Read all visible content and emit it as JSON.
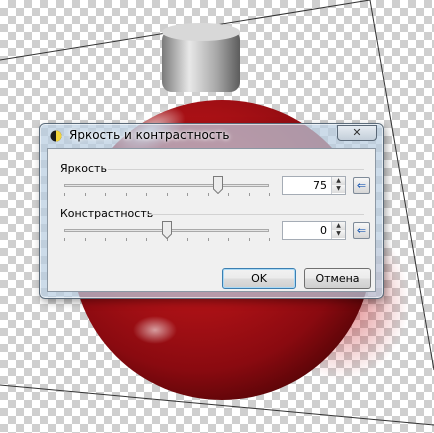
{
  "dialog": {
    "title": "Яркость и контрастность",
    "close_label": "✕",
    "brightness": {
      "label": "Яркость",
      "value": "75",
      "level": 0.75
    },
    "contrast": {
      "label": "Констрастность",
      "value": "0",
      "level": 0.5
    },
    "spin_up": "▲",
    "spin_down": "▼",
    "reset_label": "⇐",
    "ok_label": "OK",
    "cancel_label": "Отмена"
  },
  "colors": {
    "ornament_red": "#b01016",
    "cap_silver": "#c8c8c8",
    "canvas_check": "#cfcfcf"
  }
}
